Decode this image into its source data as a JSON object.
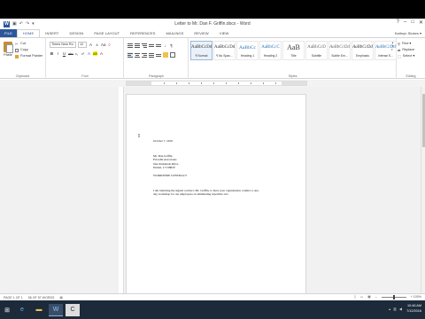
{
  "window": {
    "title": "Letter to Mr. Dan F. Griffin.docx - Word",
    "controls": [
      "?",
      "–",
      "□",
      "✕"
    ]
  },
  "qat_icons": [
    "save-icon",
    "undo-icon",
    "redo-icon",
    "customize-icon"
  ],
  "ribbon_tabs": [
    "FILE",
    "HOME",
    "INSERT",
    "DESIGN",
    "PAGE LAYOUT",
    "REFERENCES",
    "MAILINGS",
    "REVIEW",
    "VIEW"
  ],
  "active_tab": "HOME",
  "user": "Kathryn Stokes ▾",
  "clipboard": {
    "paste": "Paste",
    "cut": "Cut",
    "copy": "Copy",
    "format_painter": "Format Painter",
    "label": "Clipboard"
  },
  "font": {
    "name": "Times New Ro",
    "size": "12",
    "label": "Font"
  },
  "paragraph": {
    "label": "Paragraph"
  },
  "styles": {
    "label": "Styles",
    "items": [
      {
        "sample": "AaBbCcDd",
        "name": "¶ Normal",
        "selected": true
      },
      {
        "sample": "AaBbCcDd",
        "name": "¶ No Spac...",
        "selected": false
      },
      {
        "sample": "AaBbCc",
        "name": "Heading 1",
        "selected": false
      },
      {
        "sample": "AaBbCcC",
        "name": "Heading 2",
        "selected": false
      },
      {
        "sample": "AaB",
        "name": "Title",
        "selected": false
      },
      {
        "sample": "AaBbCcD",
        "name": "Subtitle",
        "selected": false
      },
      {
        "sample": "AaBbCcDd",
        "name": "Subtle Em...",
        "selected": false
      },
      {
        "sample": "AaBbCcDd",
        "name": "Emphasis",
        "selected": false
      },
      {
        "sample": "AaBbCcDd",
        "name": "Intense E...",
        "selected": false
      }
    ]
  },
  "editing": {
    "find": "Find ▾",
    "replace": "Replace",
    "select": "Select ▾",
    "label": "Editing"
  },
  "document": {
    "date": "October 7, 2016",
    "address": [
      "Mr. Dan Griffin",
      "Ericsdin Associates",
      "One Parklands Drive",
      "Darien, CT 06820"
    ],
    "subject": "WORKSHOP CONTRACT",
    "body": [
      "I am returning the signed contract, Mr. Griffin, to have your organization conduct a one-",
      "day workshop for our employees on eliminating repetitive stra"
    ]
  },
  "status": {
    "page": "PAGE 1 OF 1",
    "words": "56 OF 57 WORDS",
    "zoom": "+ 100%"
  },
  "taskbar": {
    "time": "10:46 AM",
    "date": "7/12/2016"
  }
}
